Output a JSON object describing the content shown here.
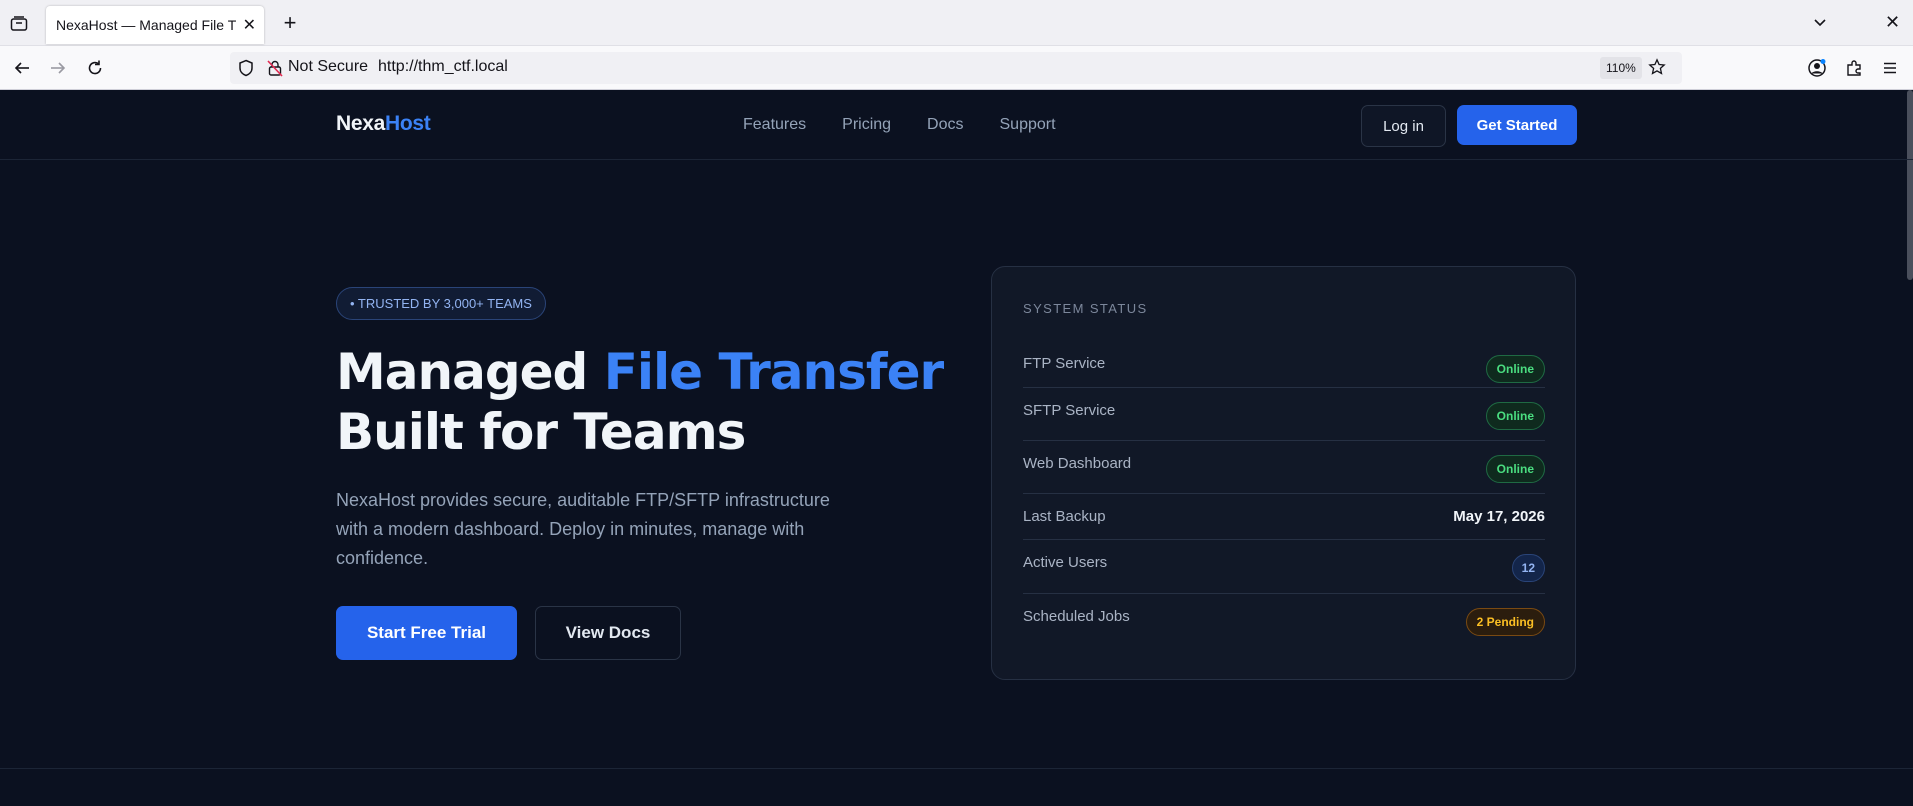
{
  "browser": {
    "tab_title": "NexaHost — Managed File Transfer",
    "security_label": "Not Secure",
    "url": "http://thm_ctf.local",
    "zoom": "110%"
  },
  "site": {
    "logo_main": "Nexa",
    "logo_accent": "Host",
    "nav": [
      "Features",
      "Pricing",
      "Docs",
      "Support"
    ],
    "login_label": "Log in",
    "get_started_label": "Get Started"
  },
  "hero": {
    "badge": "• TRUSTED BY 3,000+ TEAMS",
    "title_part1": "Managed ",
    "title_accent": "File Transfer",
    "title_line2": "Built for Teams",
    "subtitle": "NexaHost provides secure, auditable FTP/SFTP infrastructure with a modern dashboard. Deploy in minutes, manage with confidence.",
    "primary_cta": "Start Free Trial",
    "secondary_cta": "View Docs"
  },
  "status": {
    "heading": "SYSTEM STATUS",
    "rows": [
      {
        "label": "FTP Service",
        "value": "Online",
        "kind": "online"
      },
      {
        "label": "SFTP Service",
        "value": "Online",
        "kind": "online"
      },
      {
        "label": "Web Dashboard",
        "value": "Online",
        "kind": "online"
      },
      {
        "label": "Last Backup",
        "value": "May 17, 2026",
        "kind": "text"
      },
      {
        "label": "Active Users",
        "value": "12",
        "kind": "count"
      },
      {
        "label": "Scheduled Jobs",
        "value": "2 Pending",
        "kind": "pending"
      }
    ]
  },
  "colors": {
    "accent": "#3b82f6",
    "button_primary": "#2563eb",
    "page_bg": "#0b1120",
    "online": "#4ade80",
    "pending": "#fbbf24"
  },
  "icons": [
    "tab-list-icon",
    "close-icon",
    "plus-icon",
    "chevron-down-icon",
    "back-icon",
    "forward-icon",
    "reload-icon",
    "shield-icon",
    "lock-slash-icon",
    "star-icon",
    "account-icon",
    "extensions-icon",
    "menu-icon"
  ]
}
